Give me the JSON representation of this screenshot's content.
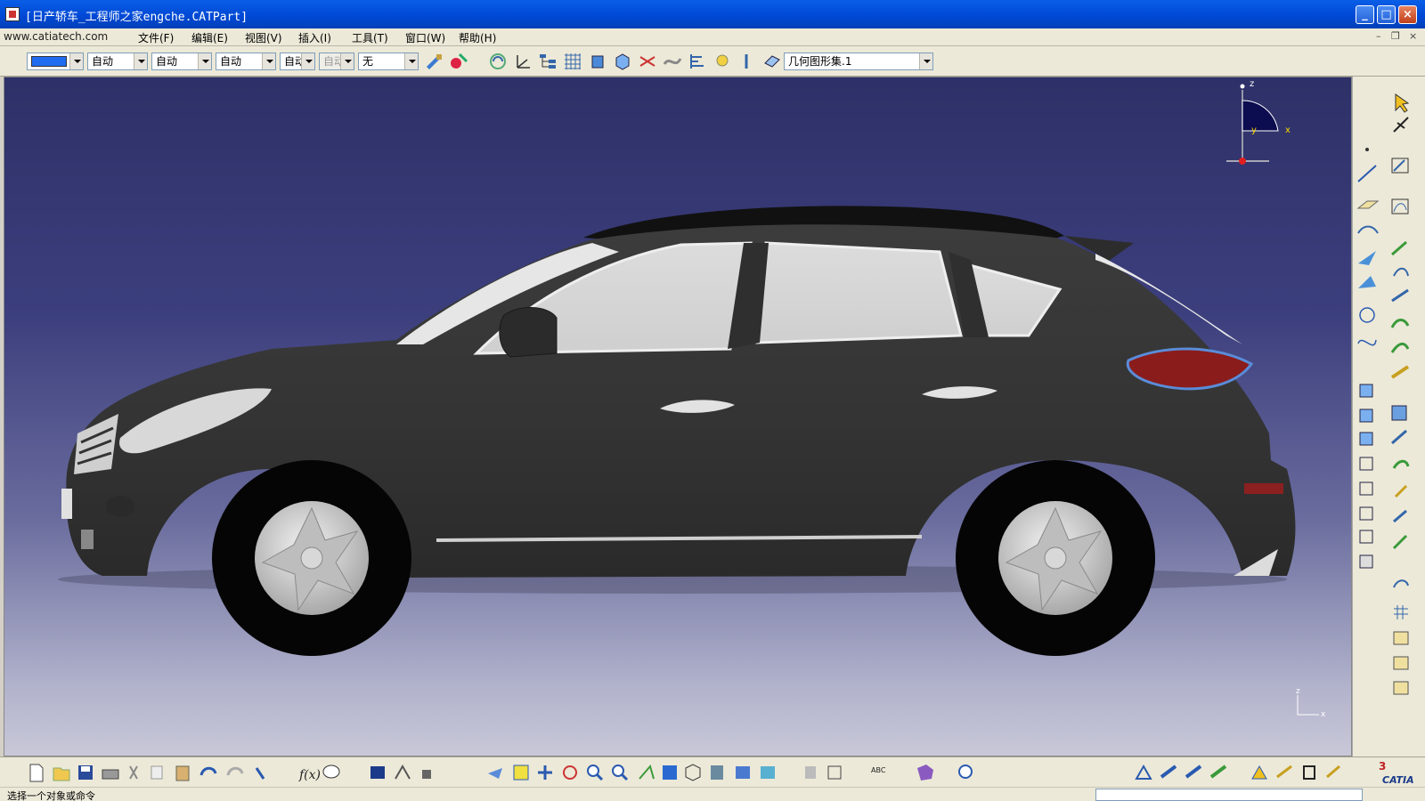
{
  "window": {
    "title": "[日产轿车_工程师之家engche.CATPart]",
    "controls": {
      "minimize": "_",
      "maximize": "□",
      "close": "×"
    }
  },
  "menubar": {
    "watermark": "www.catiatech.com",
    "items": [
      "文件(F)",
      "编辑(E)",
      "视图(V)",
      "插入(I)",
      "工具(T)",
      "窗口(W)",
      "帮助(H)"
    ],
    "mdi_controls": [
      "–",
      "❐",
      "×"
    ]
  },
  "toolbar_top": {
    "color_value": "#1f6cf0",
    "combos": [
      "自动",
      "自动",
      "自动",
      "自动",
      "自动",
      "无"
    ],
    "geometric_set": "几何图形集.1"
  },
  "viewport": {
    "compass_labels": {
      "z": "z",
      "x": "x",
      "y": "y"
    },
    "axis_labels": {
      "z": "z",
      "x": "x"
    },
    "background_top": "#2e3068",
    "background_bottom": "#c8c8d8",
    "car_body_color": "#3a3a3a"
  },
  "bottom_toolbar": {
    "brand": "CATIA"
  },
  "statusbar": {
    "text": "选择一个对象或命令"
  }
}
